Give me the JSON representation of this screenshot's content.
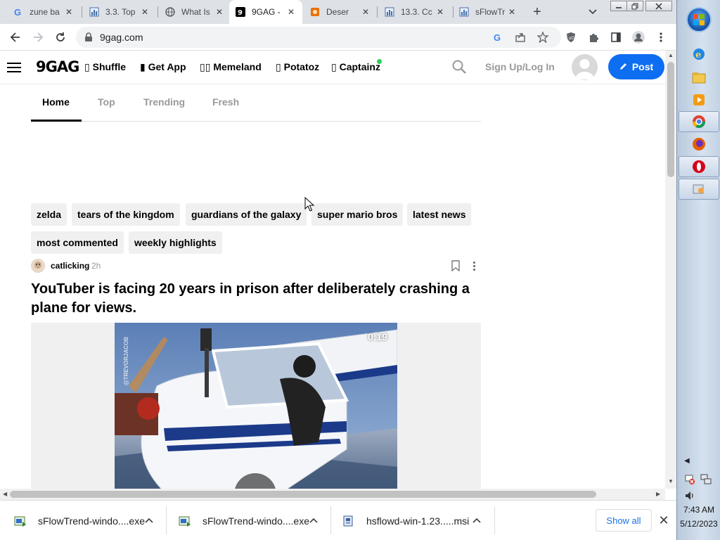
{
  "browser": {
    "tabs": [
      {
        "title": "zune ba",
        "icon": "google-icon"
      },
      {
        "title": "3.3. Top",
        "icon": "chart-doc-icon"
      },
      {
        "title": "What Is",
        "icon": "globe-icon"
      },
      {
        "title": "9GAG -",
        "icon": "9gag-icon",
        "active": true
      },
      {
        "title": "Deser",
        "icon": "orange-shield-icon"
      },
      {
        "title": "13.3. Cc",
        "icon": "chart-doc-icon"
      },
      {
        "title": "sFlowTr",
        "icon": "chart-doc-icon"
      }
    ],
    "new_tab_label": "+",
    "close_glyph": "✕",
    "url": "9gag.com"
  },
  "site": {
    "logo": "9GAG",
    "nav": [
      {
        "label": "Shuffle",
        "glyph": "▯"
      },
      {
        "label": "Get App",
        "glyph": "▮"
      },
      {
        "label": "Memeland",
        "glyph": "▯▯"
      },
      {
        "label": "Potatoz",
        "glyph": "▯"
      },
      {
        "label": "Captainz",
        "glyph": "▯"
      }
    ],
    "signup": "Sign Up/Log In",
    "post_button": "Post",
    "tabs": [
      "Home",
      "Top",
      "Trending",
      "Fresh"
    ],
    "chips": [
      "zelda",
      "tears of the kingdom",
      "guardians of the galaxy",
      "super mario bros",
      "latest news",
      "most commented",
      "weekly highlights"
    ]
  },
  "post": {
    "author": "catlicking",
    "time": "2h",
    "title": "YouTuber is facing 20 years in prison after deliberately crashing a plane for views.",
    "video_duration": "0:19",
    "watermark": "@TREVORJACOB"
  },
  "downloads": {
    "items": [
      {
        "name": "sFlowTrend-windo....exe"
      },
      {
        "name": "sFlowTrend-windo....exe"
      },
      {
        "name": "hsflowd-win-1.23.....msi"
      }
    ],
    "show_all": "Show all",
    "close_glyph": "✕"
  },
  "taskbar": {
    "time": "7:43 AM",
    "date": "5/12/2023"
  },
  "colors": {
    "accent": "#0d6ef1",
    "tab_strip": "#dee1e6",
    "chip_bg": "#f0f0f0"
  }
}
